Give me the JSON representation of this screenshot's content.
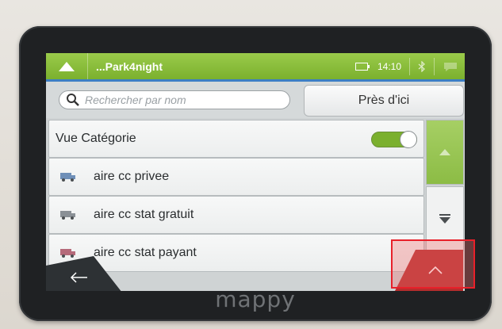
{
  "device": {
    "brand": "mappy"
  },
  "topbar": {
    "title": "...Park4night",
    "time": "14:10"
  },
  "search": {
    "placeholder": "Rechercher par nom",
    "nearby_label": "Près d'ici"
  },
  "list": {
    "category_view": {
      "label": "Vue Catégorie",
      "toggle_on": true
    },
    "items": [
      {
        "label": "aire cc privee",
        "icon": "camper-van-icon"
      },
      {
        "label": "aire cc stat gratuit",
        "icon": "camper-van-icon"
      },
      {
        "label": "aire cc stat payant",
        "icon": "camper-van-icon"
      }
    ]
  },
  "colors": {
    "accent": "#7bb02e",
    "up_button": "#b62d2d",
    "highlight": "#e8202a"
  }
}
